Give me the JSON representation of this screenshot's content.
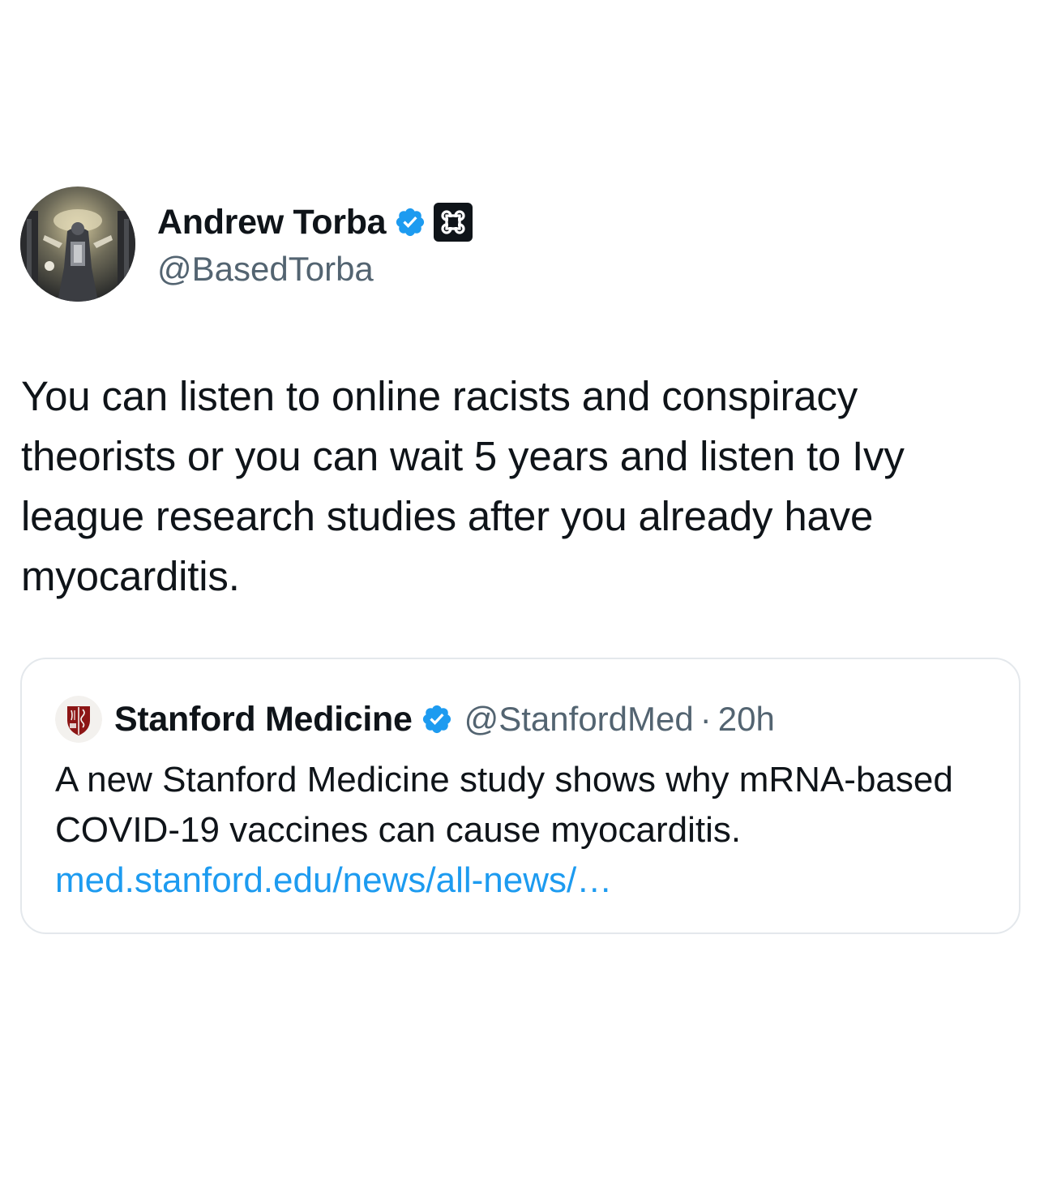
{
  "author": {
    "display_name": "Andrew Torba",
    "handle": "@BasedTorba",
    "verified_icon": "verified-badge-icon",
    "affiliation_icon": "command-key-icon"
  },
  "tweet": {
    "text": "You can listen to online racists and conspiracy theorists or you can wait 5 years and listen to Ivy league research studies after you already have myocarditis."
  },
  "quoted_tweet": {
    "display_name": "Stanford Medicine",
    "handle": "@StanfordMed",
    "separator": "·",
    "time": "20h",
    "text": "A new Stanford Medicine study shows why mRNA-based COVID-19 vaccines can cause myocarditis.",
    "link_text": "med.stanford.edu/news/all-news/…",
    "avatar_icon": "stanford-shield-icon"
  },
  "colors": {
    "verified_blue": "#1d9bf0",
    "text_primary": "#0f1419",
    "text_secondary": "#536471",
    "link": "#1d9bf0",
    "stanford_red": "#8c1515"
  }
}
